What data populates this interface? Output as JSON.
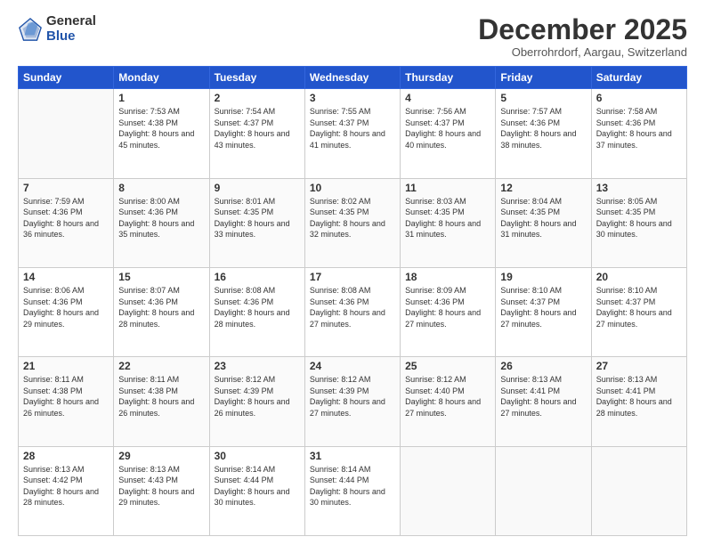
{
  "logo": {
    "general": "General",
    "blue": "Blue"
  },
  "title": "December 2025",
  "location": "Oberrohrdorf, Aargau, Switzerland",
  "weekdays": [
    "Sunday",
    "Monday",
    "Tuesday",
    "Wednesday",
    "Thursday",
    "Friday",
    "Saturday"
  ],
  "weeks": [
    [
      {
        "day": "",
        "sunrise": "",
        "sunset": "",
        "daylight": ""
      },
      {
        "day": "1",
        "sunrise": "Sunrise: 7:53 AM",
        "sunset": "Sunset: 4:38 PM",
        "daylight": "Daylight: 8 hours and 45 minutes."
      },
      {
        "day": "2",
        "sunrise": "Sunrise: 7:54 AM",
        "sunset": "Sunset: 4:37 PM",
        "daylight": "Daylight: 8 hours and 43 minutes."
      },
      {
        "day": "3",
        "sunrise": "Sunrise: 7:55 AM",
        "sunset": "Sunset: 4:37 PM",
        "daylight": "Daylight: 8 hours and 41 minutes."
      },
      {
        "day": "4",
        "sunrise": "Sunrise: 7:56 AM",
        "sunset": "Sunset: 4:37 PM",
        "daylight": "Daylight: 8 hours and 40 minutes."
      },
      {
        "day": "5",
        "sunrise": "Sunrise: 7:57 AM",
        "sunset": "Sunset: 4:36 PM",
        "daylight": "Daylight: 8 hours and 38 minutes."
      },
      {
        "day": "6",
        "sunrise": "Sunrise: 7:58 AM",
        "sunset": "Sunset: 4:36 PM",
        "daylight": "Daylight: 8 hours and 37 minutes."
      }
    ],
    [
      {
        "day": "7",
        "sunrise": "Sunrise: 7:59 AM",
        "sunset": "Sunset: 4:36 PM",
        "daylight": "Daylight: 8 hours and 36 minutes."
      },
      {
        "day": "8",
        "sunrise": "Sunrise: 8:00 AM",
        "sunset": "Sunset: 4:36 PM",
        "daylight": "Daylight: 8 hours and 35 minutes."
      },
      {
        "day": "9",
        "sunrise": "Sunrise: 8:01 AM",
        "sunset": "Sunset: 4:35 PM",
        "daylight": "Daylight: 8 hours and 33 minutes."
      },
      {
        "day": "10",
        "sunrise": "Sunrise: 8:02 AM",
        "sunset": "Sunset: 4:35 PM",
        "daylight": "Daylight: 8 hours and 32 minutes."
      },
      {
        "day": "11",
        "sunrise": "Sunrise: 8:03 AM",
        "sunset": "Sunset: 4:35 PM",
        "daylight": "Daylight: 8 hours and 31 minutes."
      },
      {
        "day": "12",
        "sunrise": "Sunrise: 8:04 AM",
        "sunset": "Sunset: 4:35 PM",
        "daylight": "Daylight: 8 hours and 31 minutes."
      },
      {
        "day": "13",
        "sunrise": "Sunrise: 8:05 AM",
        "sunset": "Sunset: 4:35 PM",
        "daylight": "Daylight: 8 hours and 30 minutes."
      }
    ],
    [
      {
        "day": "14",
        "sunrise": "Sunrise: 8:06 AM",
        "sunset": "Sunset: 4:36 PM",
        "daylight": "Daylight: 8 hours and 29 minutes."
      },
      {
        "day": "15",
        "sunrise": "Sunrise: 8:07 AM",
        "sunset": "Sunset: 4:36 PM",
        "daylight": "Daylight: 8 hours and 28 minutes."
      },
      {
        "day": "16",
        "sunrise": "Sunrise: 8:08 AM",
        "sunset": "Sunset: 4:36 PM",
        "daylight": "Daylight: 8 hours and 28 minutes."
      },
      {
        "day": "17",
        "sunrise": "Sunrise: 8:08 AM",
        "sunset": "Sunset: 4:36 PM",
        "daylight": "Daylight: 8 hours and 27 minutes."
      },
      {
        "day": "18",
        "sunrise": "Sunrise: 8:09 AM",
        "sunset": "Sunset: 4:36 PM",
        "daylight": "Daylight: 8 hours and 27 minutes."
      },
      {
        "day": "19",
        "sunrise": "Sunrise: 8:10 AM",
        "sunset": "Sunset: 4:37 PM",
        "daylight": "Daylight: 8 hours and 27 minutes."
      },
      {
        "day": "20",
        "sunrise": "Sunrise: 8:10 AM",
        "sunset": "Sunset: 4:37 PM",
        "daylight": "Daylight: 8 hours and 27 minutes."
      }
    ],
    [
      {
        "day": "21",
        "sunrise": "Sunrise: 8:11 AM",
        "sunset": "Sunset: 4:38 PM",
        "daylight": "Daylight: 8 hours and 26 minutes."
      },
      {
        "day": "22",
        "sunrise": "Sunrise: 8:11 AM",
        "sunset": "Sunset: 4:38 PM",
        "daylight": "Daylight: 8 hours and 26 minutes."
      },
      {
        "day": "23",
        "sunrise": "Sunrise: 8:12 AM",
        "sunset": "Sunset: 4:39 PM",
        "daylight": "Daylight: 8 hours and 26 minutes."
      },
      {
        "day": "24",
        "sunrise": "Sunrise: 8:12 AM",
        "sunset": "Sunset: 4:39 PM",
        "daylight": "Daylight: 8 hours and 27 minutes."
      },
      {
        "day": "25",
        "sunrise": "Sunrise: 8:12 AM",
        "sunset": "Sunset: 4:40 PM",
        "daylight": "Daylight: 8 hours and 27 minutes."
      },
      {
        "day": "26",
        "sunrise": "Sunrise: 8:13 AM",
        "sunset": "Sunset: 4:41 PM",
        "daylight": "Daylight: 8 hours and 27 minutes."
      },
      {
        "day": "27",
        "sunrise": "Sunrise: 8:13 AM",
        "sunset": "Sunset: 4:41 PM",
        "daylight": "Daylight: 8 hours and 28 minutes."
      }
    ],
    [
      {
        "day": "28",
        "sunrise": "Sunrise: 8:13 AM",
        "sunset": "Sunset: 4:42 PM",
        "daylight": "Daylight: 8 hours and 28 minutes."
      },
      {
        "day": "29",
        "sunrise": "Sunrise: 8:13 AM",
        "sunset": "Sunset: 4:43 PM",
        "daylight": "Daylight: 8 hours and 29 minutes."
      },
      {
        "day": "30",
        "sunrise": "Sunrise: 8:14 AM",
        "sunset": "Sunset: 4:44 PM",
        "daylight": "Daylight: 8 hours and 30 minutes."
      },
      {
        "day": "31",
        "sunrise": "Sunrise: 8:14 AM",
        "sunset": "Sunset: 4:44 PM",
        "daylight": "Daylight: 8 hours and 30 minutes."
      },
      {
        "day": "",
        "sunrise": "",
        "sunset": "",
        "daylight": ""
      },
      {
        "day": "",
        "sunrise": "",
        "sunset": "",
        "daylight": ""
      },
      {
        "day": "",
        "sunrise": "",
        "sunset": "",
        "daylight": ""
      }
    ]
  ]
}
